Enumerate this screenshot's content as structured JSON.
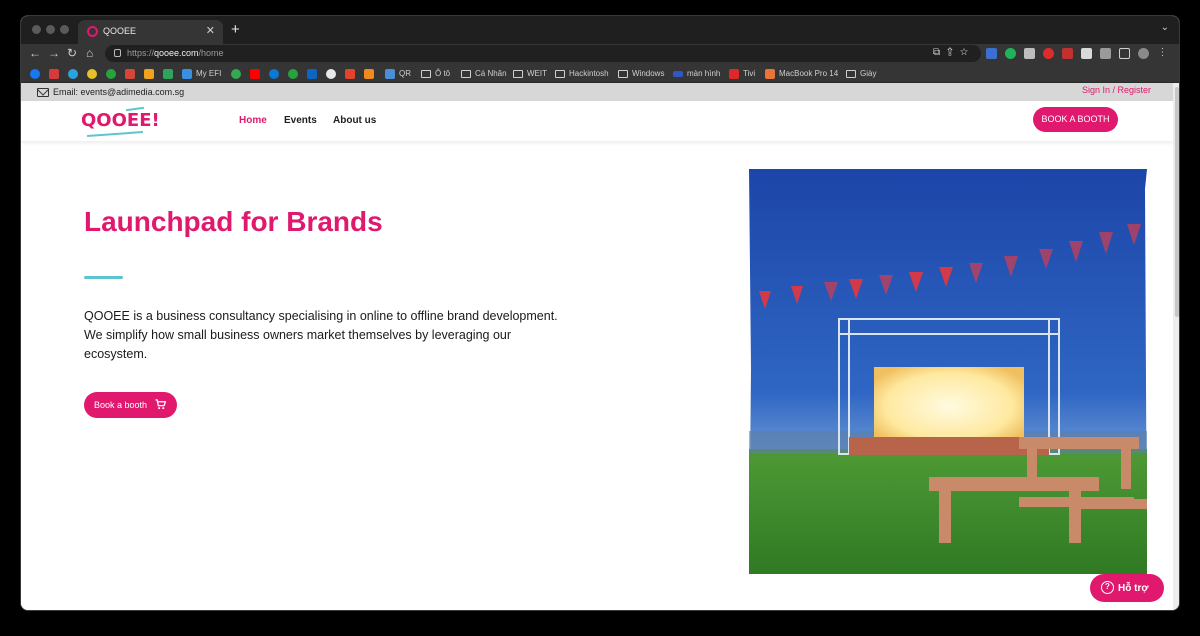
{
  "browser": {
    "tab_title": "QOOEE",
    "url_prefix": "https://",
    "url_domain": "qooee.com",
    "url_path": "/home",
    "bookmarks": [
      "My EFI",
      "QR",
      "Ô tô",
      "Cá Nhân",
      "WEIT",
      "Hackintosh",
      "Windows",
      "màn hình",
      "Tivi",
      "MacBook Pro 14",
      "Giày"
    ]
  },
  "topbar": {
    "email": "Email: events@adimedia.com.sg",
    "signin": "Sign In / Register"
  },
  "header": {
    "logo": "QOOEE!",
    "nav": [
      "Home",
      "Events",
      "About us"
    ],
    "cta": "BOOK A BOOTH"
  },
  "hero": {
    "title": "Launchpad for Brands",
    "description": "QOOEE is a business consultancy specialising in online to offline brand development. We simplify how small business owners market themselves by leveraging our ecosystem.",
    "button": "Book a booth"
  },
  "support": {
    "label": "Hỗ trợ"
  },
  "colors": {
    "brand": "#e0196e",
    "accent": "#5ec4cf"
  }
}
